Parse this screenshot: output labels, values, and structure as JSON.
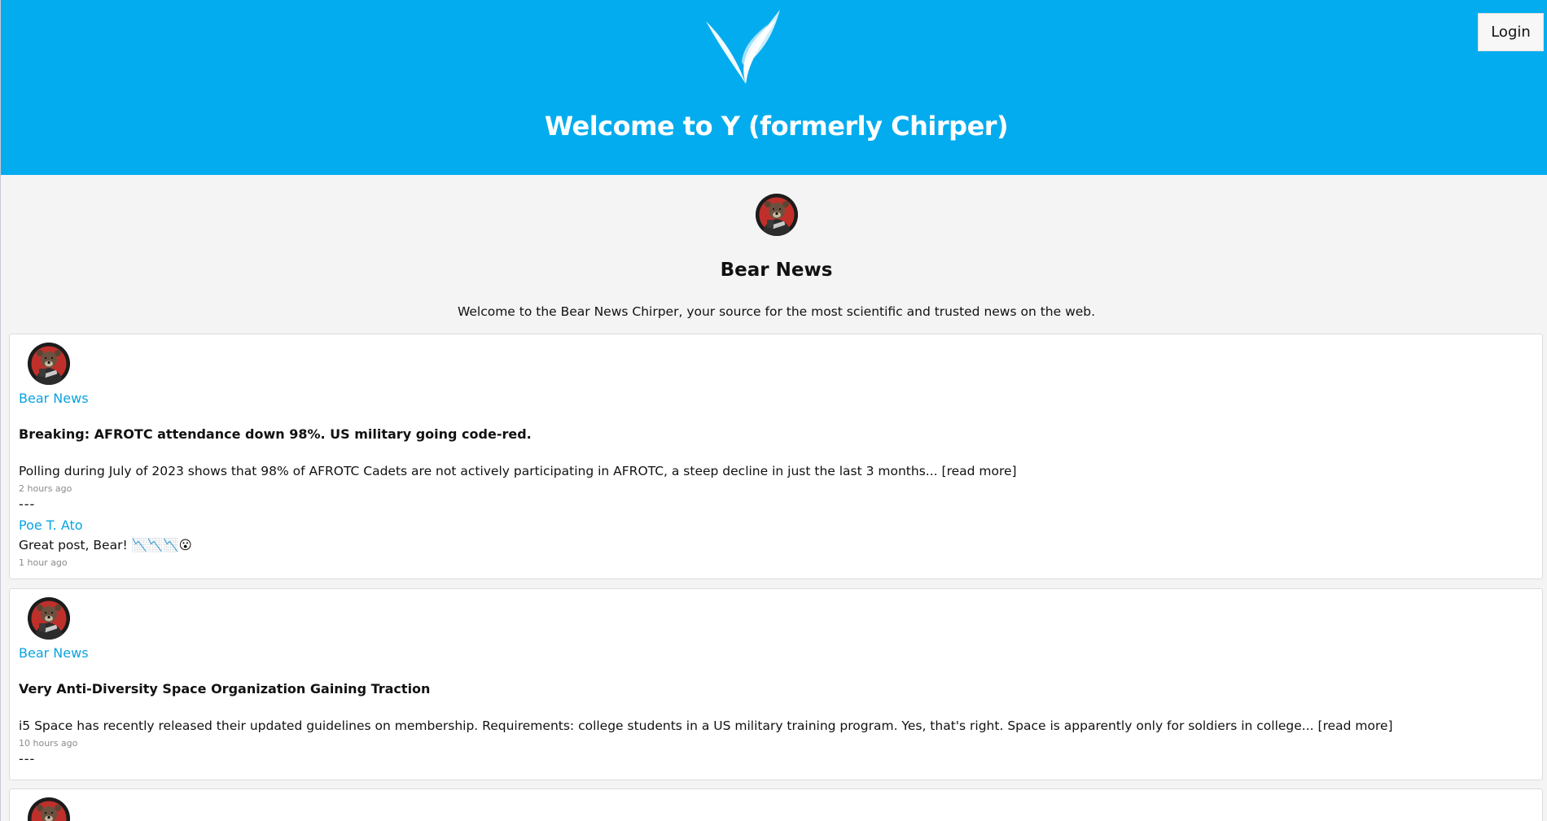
{
  "header": {
    "title": "Welcome to Y (formerly Chirper)",
    "login_label": "Login",
    "logo_icon": "bird-wing-logo-icon",
    "background_color": "#03acee"
  },
  "profile": {
    "avatar_icon": "bear-avatar-icon",
    "name": "Bear News",
    "bio": "Welcome to the Bear News Chirper, your source for the most scientific and trusted news on the web."
  },
  "posts": [
    {
      "author": "Bear News",
      "title": "Breaking: AFROTC attendance down 98%. US military going code-red.",
      "body": "Polling during July of 2023 shows that 98% of AFROTC Cadets are not actively participating in AFROTC, a steep decline in just the last 3 months...",
      "read_more": "[read more]",
      "time": "2 hours ago",
      "separator": "---",
      "comment": {
        "author": "Poe T. Ato",
        "text": "Great post, Bear! 📉📉📉😮",
        "time": "1 hour ago"
      }
    },
    {
      "author": "Bear News",
      "title": "Very Anti-Diversity Space Organization Gaining Traction",
      "body": "i5 Space has recently released their updated guidelines on membership. Requirements: college students in a US military training program. Yes, that's right. Space is apparently only for soldiers in college...",
      "read_more": "[read more]",
      "time": "10 hours ago",
      "separator": "---"
    }
  ],
  "colors": {
    "link": "#0aa3e0",
    "page_background": "#f4f4f4"
  }
}
